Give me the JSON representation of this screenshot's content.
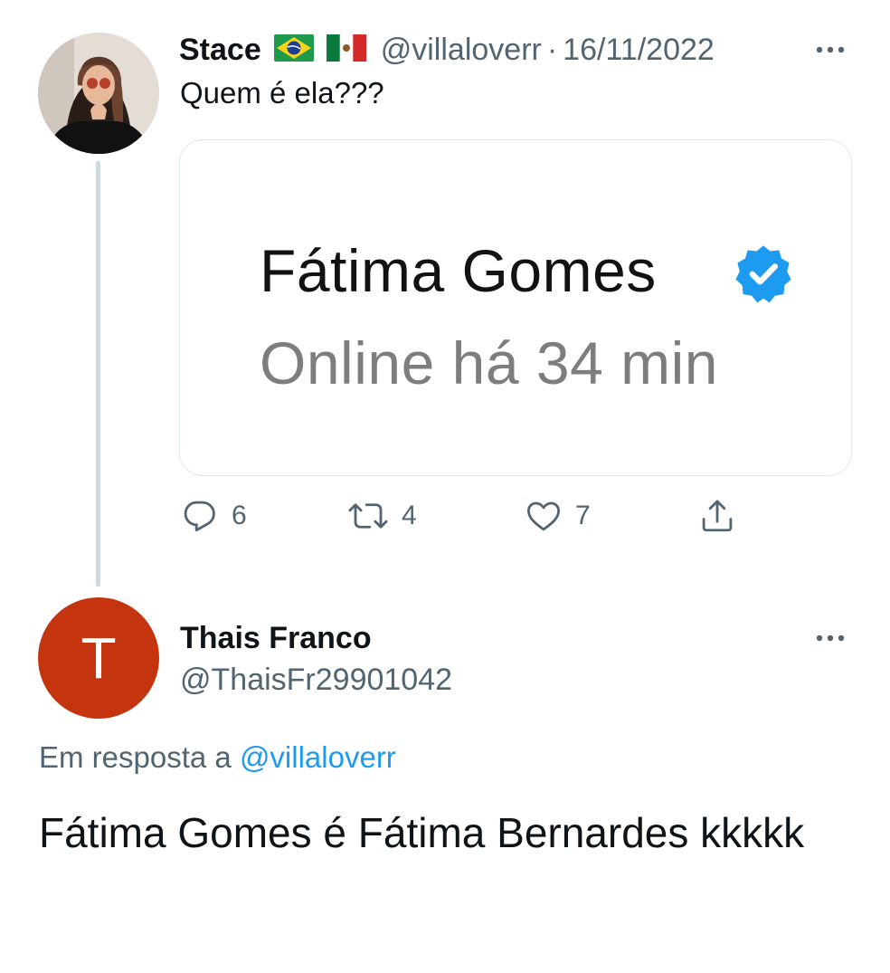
{
  "tweet": {
    "author_name": "Stace",
    "flags": [
      "flag-brazil",
      "flag-mexico"
    ],
    "handle": "@villaloverr",
    "separator": "·",
    "date": "16/11/2022",
    "text": "Quem é ela???",
    "card": {
      "title": "Fátima Gomes",
      "status": "Online há 34 min",
      "verified_icon": "verified-badge-icon"
    },
    "actions": {
      "replies": "6",
      "retweets": "4",
      "likes": "7"
    }
  },
  "reply": {
    "avatar_letter": "T",
    "author_name": "Thais Franco",
    "handle": "@ThaisFr29901042",
    "reply_prefix": "Em resposta a",
    "reply_to": "@villaloverr",
    "text": "Fátima Gomes é Fátima Bernardes kkkkk"
  },
  "colors": {
    "text": "#0f1419",
    "secondary": "#536471",
    "link": "#1d9bf0",
    "verified": "#1d9bf0",
    "avatar_bg": "#c4340f",
    "thread_line": "#cfd9de"
  }
}
